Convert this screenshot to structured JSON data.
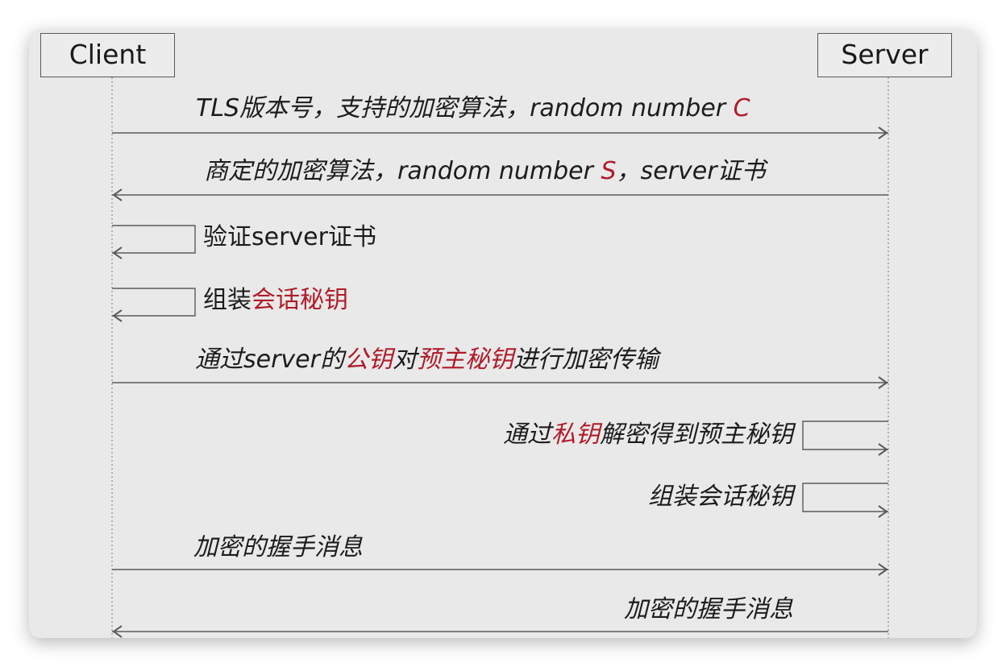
{
  "participants": {
    "client": "Client",
    "server": "Server"
  },
  "messages": [
    {
      "direction": "client-to-server",
      "italic": true,
      "parts": [
        {
          "text": "TLS版本号，支持的加密算法，random number "
        },
        {
          "text": "C",
          "highlight": true
        }
      ]
    },
    {
      "direction": "server-to-client",
      "italic": true,
      "parts": [
        {
          "text": "商定的加密算法，random number "
        },
        {
          "text": "S",
          "highlight": true
        },
        {
          "text": "，server证书"
        }
      ]
    },
    {
      "direction": "client-self",
      "italic": false,
      "parts": [
        {
          "text": "验证server证书"
        }
      ]
    },
    {
      "direction": "client-self",
      "italic": false,
      "parts": [
        {
          "text": "组装"
        },
        {
          "text": "会话秘钥",
          "highlight": true
        }
      ]
    },
    {
      "direction": "client-to-server",
      "italic": true,
      "parts": [
        {
          "text": "通过server的"
        },
        {
          "text": "公钥",
          "highlight": true
        },
        {
          "text": "对"
        },
        {
          "text": "预主秘钥",
          "highlight": true
        },
        {
          "text": "进行加密传输"
        }
      ]
    },
    {
      "direction": "server-self",
      "italic": true,
      "parts": [
        {
          "text": "通过"
        },
        {
          "text": "私钥",
          "highlight": true
        },
        {
          "text": "解密得到预主秘钥"
        }
      ]
    },
    {
      "direction": "server-self",
      "italic": true,
      "parts": [
        {
          "text": "组装会话秘钥"
        }
      ]
    },
    {
      "direction": "client-to-server",
      "italic": true,
      "parts": [
        {
          "text": "加密的握手消息"
        }
      ]
    },
    {
      "direction": "server-to-client",
      "italic": true,
      "parts": [
        {
          "text": "加密的握手消息"
        }
      ]
    }
  ],
  "colors": {
    "highlight": "#b01c2a",
    "text": "#1c1c1c",
    "line": "#5a5a5a",
    "background": "#e9e9e9"
  }
}
